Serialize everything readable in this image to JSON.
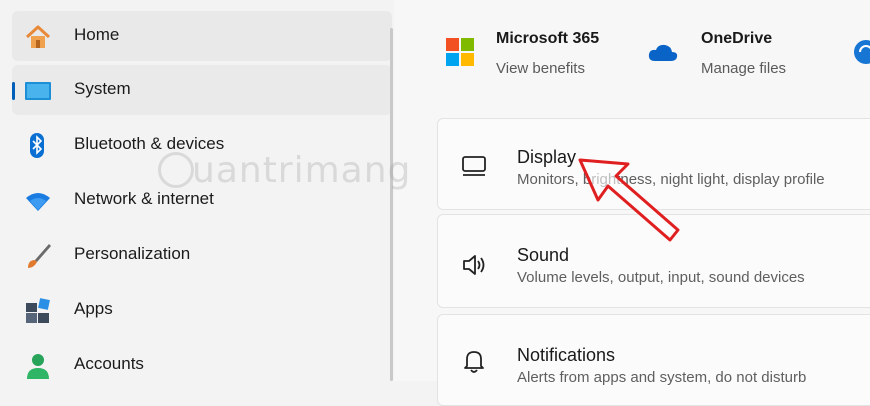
{
  "sidebar": {
    "items": [
      {
        "label": "Home",
        "icon": "home-icon"
      },
      {
        "label": "System",
        "icon": "system-icon"
      },
      {
        "label": "Bluetooth & devices",
        "icon": "bluetooth-icon"
      },
      {
        "label": "Network & internet",
        "icon": "wifi-icon"
      },
      {
        "label": "Personalization",
        "icon": "paintbrush-icon"
      },
      {
        "label": "Apps",
        "icon": "apps-icon"
      },
      {
        "label": "Accounts",
        "icon": "account-icon"
      }
    ],
    "selected": "System"
  },
  "header_tiles": [
    {
      "title": "Microsoft 365",
      "subtitle": "View benefits",
      "icon": "microsoft-logo-icon"
    },
    {
      "title": "OneDrive",
      "subtitle": "Manage files",
      "icon": "onedrive-cloud-icon"
    }
  ],
  "cards": [
    {
      "title": "Display",
      "subtitle": "Monitors, brightness, night light, display profile",
      "icon": "monitor-icon"
    },
    {
      "title": "Sound",
      "subtitle": "Volume levels, output, input, sound devices",
      "icon": "speaker-icon"
    },
    {
      "title": "Notifications",
      "subtitle": "Alerts from apps and system, do not disturb",
      "icon": "bell-icon"
    }
  ],
  "watermark": {
    "text": "uantrimang"
  },
  "colors": {
    "accent": "#005fb8",
    "annotation_arrow": "#e02020"
  }
}
